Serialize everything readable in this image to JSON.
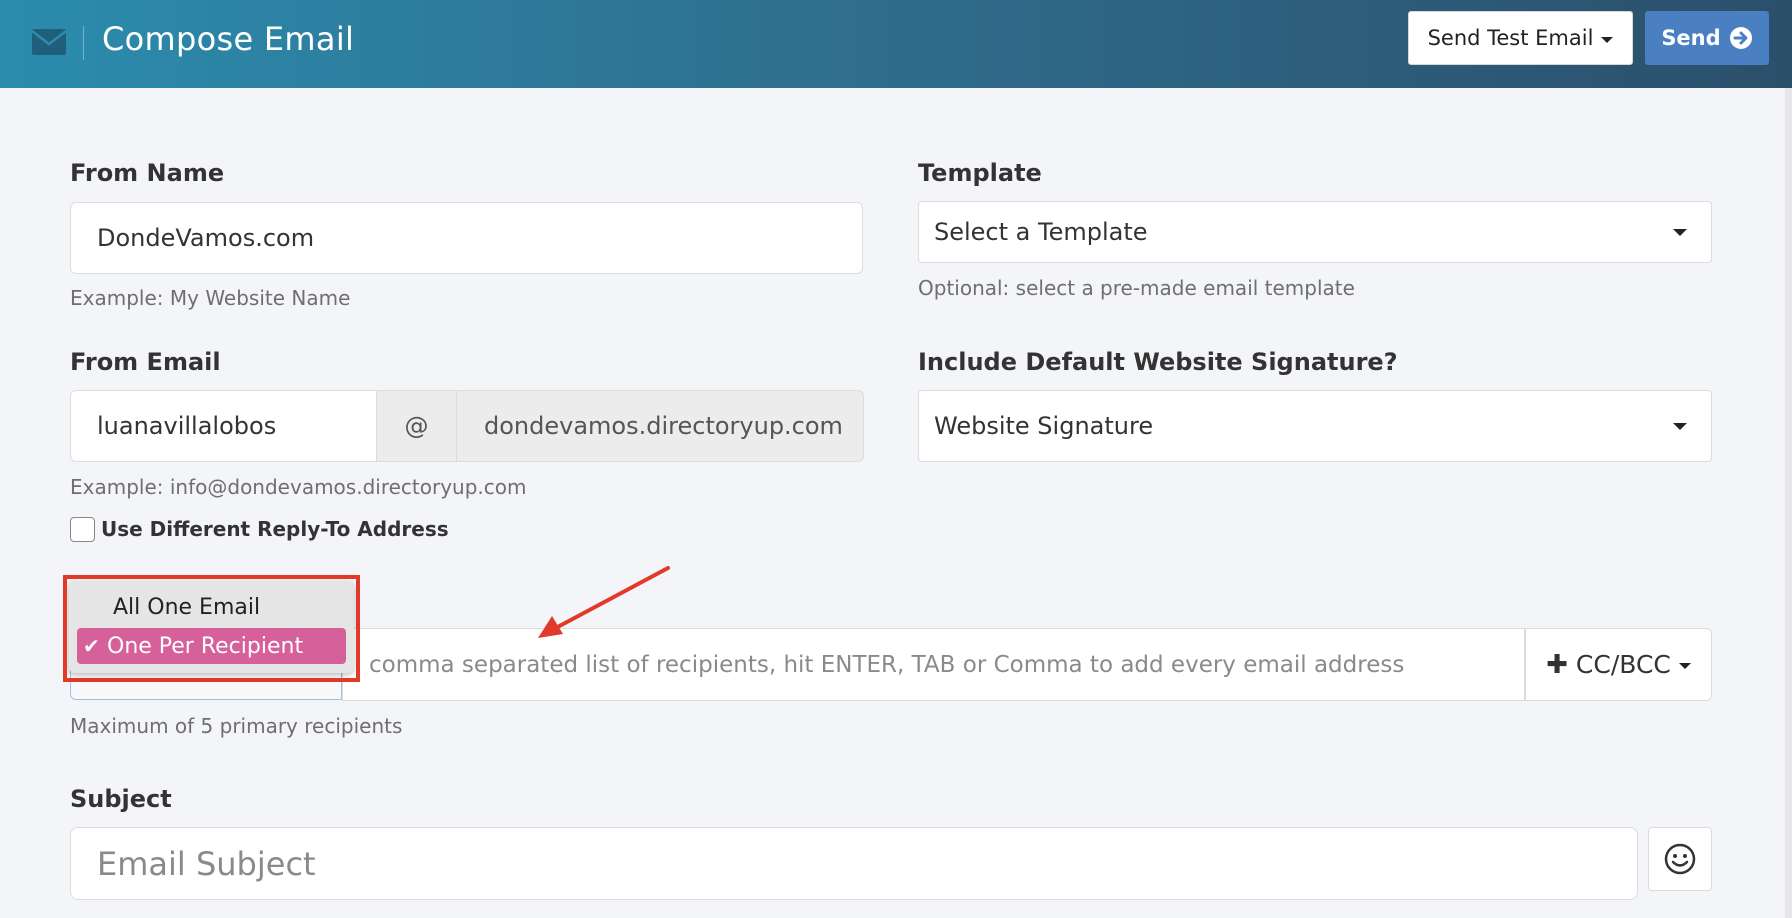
{
  "header": {
    "title": "Compose Email",
    "send_test_label": "Send Test Email",
    "send_label": "Send"
  },
  "form": {
    "from_name": {
      "label": "From Name",
      "value": "DondeVamos.com",
      "help": "Example: My Website Name"
    },
    "template": {
      "label": "Template",
      "selected": "Select a Template",
      "help": "Optional: select a pre-made email template"
    },
    "from_email": {
      "label": "From Email",
      "local_part": "luanavillalobos",
      "at": "@",
      "domain": "dondevamos.directoryup.com",
      "help": "Example: info@dondevamos.directoryup.com"
    },
    "signature": {
      "label": "Include Default Website Signature?",
      "selected": "Website Signature"
    },
    "reply_to": {
      "label": "Use Different Reply-To Address",
      "checked": false
    },
    "recipients": {
      "placeholder": "comma separated list of recipients, hit ENTER, TAB or Comma to add every email address",
      "cc_bcc_label": "CC/BCC",
      "help": "Maximum of 5 primary recipients",
      "mode_options": [
        "All One Email",
        "One Per Recipient"
      ],
      "mode_selected": "One Per Recipient"
    },
    "subject": {
      "label": "Subject",
      "placeholder": "Email Subject"
    }
  },
  "colors": {
    "header_gradient_start": "#2b8cad",
    "header_gradient_end": "#2b4f6b",
    "send_button": "#4a7fc2",
    "selected_option": "#d6609a",
    "annotation_red": "#e23a2a"
  },
  "icons": {
    "header": "envelope-icon",
    "send": "arrow-circle-right-icon",
    "emoji": "smiley-icon",
    "checkmark": "check-icon",
    "plus": "plus-icon"
  }
}
